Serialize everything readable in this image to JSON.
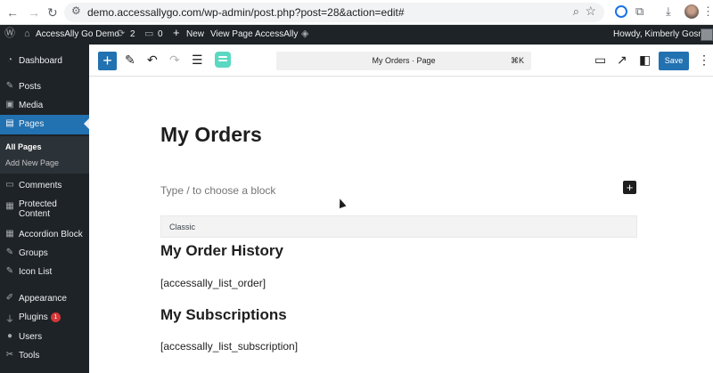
{
  "browser": {
    "url": "demo.accessallygo.com/wp-admin/post.php?post=28&action=edit#"
  },
  "adminbar": {
    "site_name": "AccessAlly Go Demo",
    "updates_count": "2",
    "comments_count": "0",
    "new_label": "New",
    "view_page": "View Page",
    "accessally": "AccessAlly",
    "howdy": "Howdy, Kimberly Gosney"
  },
  "sidebar": {
    "items": [
      {
        "label": "Dashboard",
        "icon": "dashboard-icon"
      },
      {
        "label": "Posts",
        "icon": "pin-icon"
      },
      {
        "label": "Media",
        "icon": "media-icon"
      },
      {
        "label": "Pages",
        "icon": "pages-icon"
      },
      {
        "label": "Comments",
        "icon": "comments-icon"
      },
      {
        "label": "Protected Content",
        "icon": "lock-icon"
      },
      {
        "label": "Accordion Block",
        "icon": "block-icon"
      },
      {
        "label": "Groups",
        "icon": "pin-icon"
      },
      {
        "label": "Icon List",
        "icon": "pin-icon"
      },
      {
        "label": "Appearance",
        "icon": "brush-icon"
      },
      {
        "label": "Plugins",
        "icon": "plugin-icon",
        "badge": "1"
      },
      {
        "label": "Users",
        "icon": "users-icon"
      },
      {
        "label": "Tools",
        "icon": "tools-icon"
      }
    ],
    "submenu": {
      "all_pages": "All Pages",
      "add_new_page": "Add New Page"
    }
  },
  "editor": {
    "doc_title": "My Orders · Page",
    "shortcut": "⌘K",
    "save_label": "Save"
  },
  "content": {
    "title": "My Orders",
    "placeholder": "Type / to choose a block",
    "classic_label": "Classic",
    "heading_1": "My Order History",
    "shortcode_1": "[accessally_list_order]",
    "heading_2": "My Subscriptions",
    "shortcode_2": "[accessally_list_subscription]"
  },
  "colors": {
    "wp_blue": "#2271b1",
    "admin_dark": "#1d2327",
    "badge_red": "#d63638",
    "accent_teal": "#5bd8c2"
  }
}
